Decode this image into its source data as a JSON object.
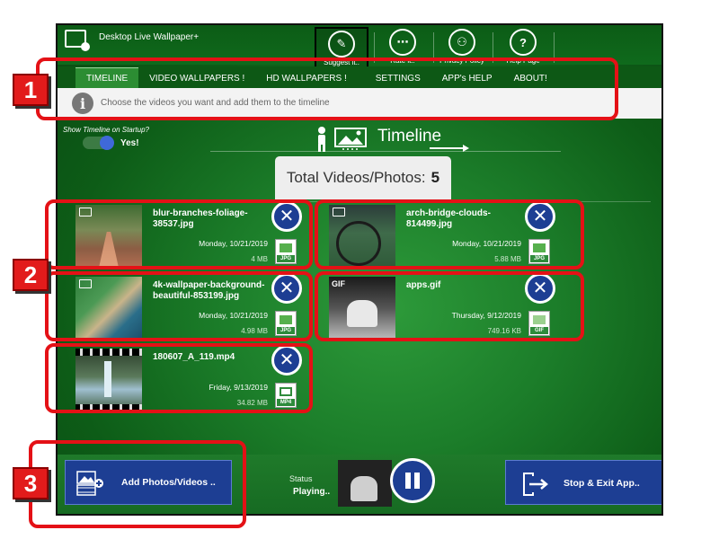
{
  "app": {
    "title": "Desktop Live Wallpaper+"
  },
  "toolbar": [
    {
      "label": "Suggest it..",
      "icon": "suggest-icon"
    },
    {
      "label": "Rate it..",
      "icon": "rate-icon"
    },
    {
      "label": "Privacy Policy",
      "icon": "privacy-icon"
    },
    {
      "label": "Help Page",
      "icon": "help-icon"
    }
  ],
  "tabs": [
    {
      "label": "TIMELINE",
      "active": true
    },
    {
      "label": "VIDEO WALLPAPERS !"
    },
    {
      "label": "HD WALLPAPERS !"
    },
    {
      "label": "SETTINGS"
    },
    {
      "label": "APP's HELP"
    },
    {
      "label": "ABOUT!"
    }
  ],
  "info": {
    "text": "Choose the videos you want and add them to the timeline"
  },
  "startup": {
    "label": "Show Timeline on Startup?",
    "value": "Yes!"
  },
  "timeline": {
    "title": "Timeline",
    "total_label": "Total Videos/Photos:",
    "total_count": "5"
  },
  "items": [
    {
      "name": "blur-branches-foliage-38537.jpg",
      "date": "Monday, 10/21/2019",
      "size": "4 MB",
      "type": "JPG"
    },
    {
      "name": "arch-bridge-clouds-814499.jpg",
      "date": "Monday, 10/21/2019",
      "size": "5.88 MB",
      "type": "JPG"
    },
    {
      "name": "4k-wallpaper-background-beautiful-853199.jpg",
      "date": "Monday, 10/21/2019",
      "size": "4.98 MB",
      "type": "JPG"
    },
    {
      "name": "apps.gif",
      "date": "Thursday, 9/12/2019",
      "size": "749.16 KB",
      "type": "GIF"
    },
    {
      "name": "180607_A_119.mp4",
      "date": "Friday, 9/13/2019",
      "size": "34.82 MB",
      "type": "MP4"
    }
  ],
  "bottom": {
    "add_label": "Add Photos/Videos ..",
    "status_label": "Status",
    "status_value": "Playing..",
    "stop_label": "Stop & Exit App.."
  },
  "callouts": [
    "1",
    "2",
    "3"
  ],
  "colors": {
    "app_green": "#0f6a1c",
    "button_blue": "#1d3e93",
    "callout_red": "#e41116"
  }
}
